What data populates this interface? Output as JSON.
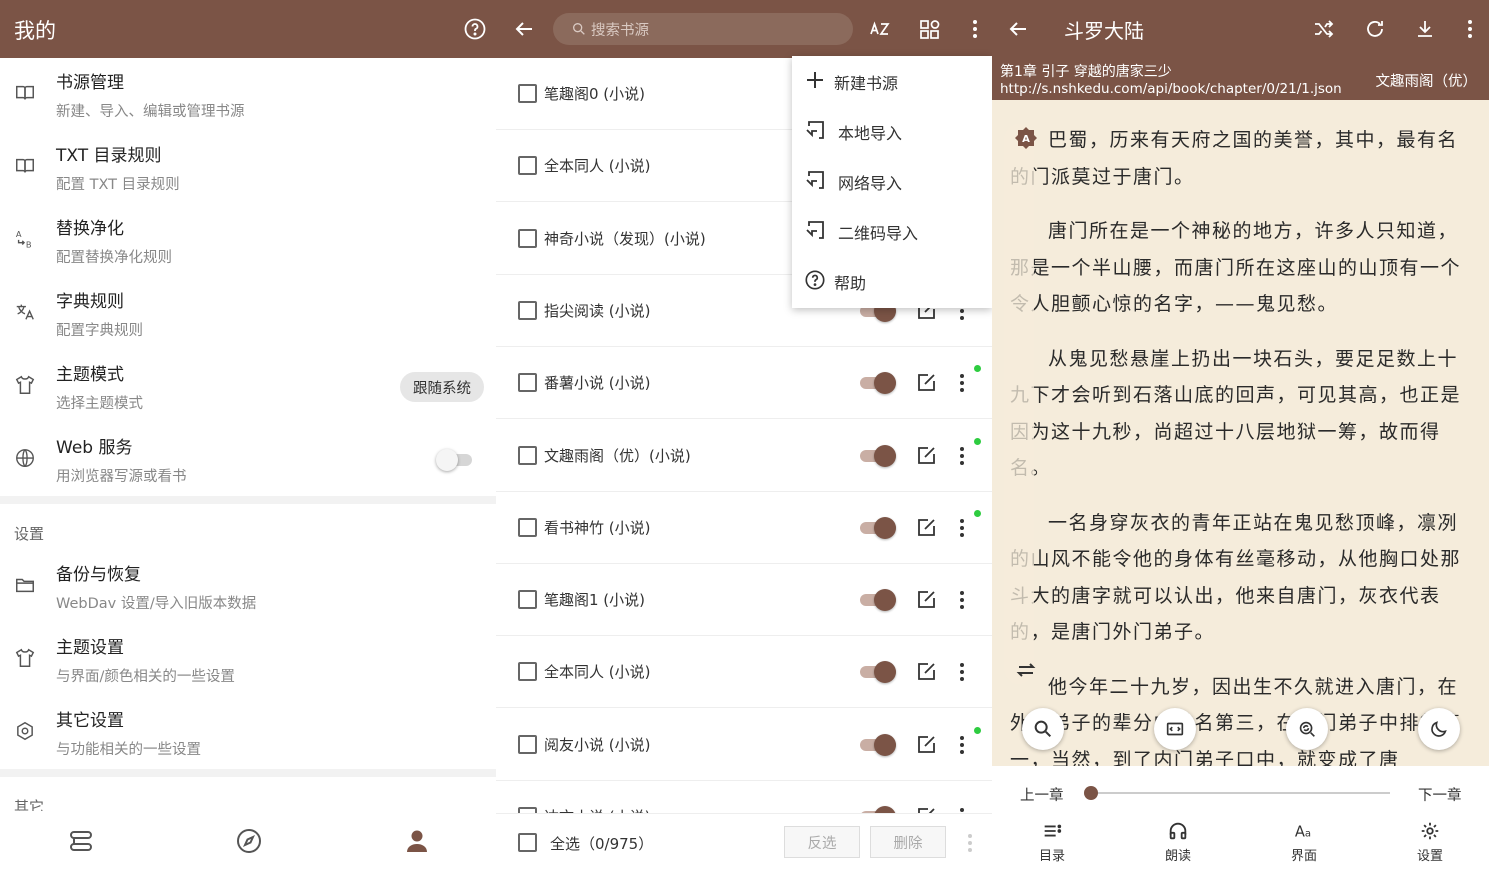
{
  "colors": {
    "primary": "#7b5446",
    "reader_bg": "#f5ecdb",
    "online_dot": "#2ecc40"
  },
  "panel1": {
    "title": "我的",
    "help_icon": "help-circle-icon",
    "items": [
      {
        "title": "书源管理",
        "subtitle": "新建、导入、编辑或管理书源",
        "icon": "book-icon"
      },
      {
        "title": "TXT 目录规则",
        "subtitle": "配置 TXT 目录规则",
        "icon": "book-icon"
      },
      {
        "title": "替换净化",
        "subtitle": "配置替换净化规则",
        "icon": "replace-icon"
      },
      {
        "title": "字典规则",
        "subtitle": "配置字典规则",
        "icon": "translate-icon"
      },
      {
        "title": "主题模式",
        "subtitle": "选择主题模式",
        "icon": "shirt-icon",
        "value": "跟随系统"
      },
      {
        "title": "Web 服务",
        "subtitle": "用浏览器写源或看书",
        "icon": "globe-icon"
      }
    ],
    "settings_section": "设置",
    "settings_items": [
      {
        "title": "备份与恢复",
        "subtitle": "WebDav 设置/导入旧版本数据",
        "icon": "folder-icon"
      },
      {
        "title": "主题设置",
        "subtitle": "与界面/颜色相关的一些设置",
        "icon": "shirt-icon"
      },
      {
        "title": "其它设置",
        "subtitle": "与功能相关的一些设置",
        "icon": "settings-icon"
      }
    ],
    "other_section": "其它",
    "nav": [
      "bookshelf-icon",
      "explore-icon",
      "profile-icon"
    ]
  },
  "panel2": {
    "search_placeholder": "搜索书源",
    "sources": [
      "笔趣阁0 (小说)",
      "全本同人 (小说)",
      "神奇小说（发现）(小说)",
      "指尖阅读 (小说)",
      "番薯小说 (小说)",
      "文趣雨阁（优）(小说)",
      "看书神竹 (小说)",
      "笔趣阁1 (小说)",
      "全本同人 (小说)",
      "阅友小说 (小说)",
      "达文小说 (小说)"
    ],
    "menu": [
      "新建书源",
      "本地导入",
      "网络导入",
      "二维码导入",
      "帮助"
    ],
    "select_all": "全选（0/975）",
    "invert": "反选",
    "delete": "删除"
  },
  "panel3": {
    "title": "斗罗大陆",
    "chapter": "第1章 引子 穿越的唐家三少",
    "url": "http://s.nshkedu.com/api/book/chapter/0/21/1.json",
    "source": "文趣雨阁（优）",
    "paragraphs": [
      "巴蜀，历来有天府之国的美誉，其中，最有名的门派莫过于唐门。",
      "唐门所在是一个神秘的地方，许多人只知道，那是一个半山腰，而唐门所在这座山的山顶有一个令人胆颤心惊的名字，——鬼见愁。",
      "从鬼见愁悬崖上扔出一块石头，要足足数上十九下才会听到石落山底的回声，可见其高，也正是因为这十九秒，尚超过十八层地狱一筹，故而得名。",
      "一名身穿灰衣的青年正站在鬼见愁顶峰，凛冽的山风不能令他的身体有丝毫移动，从他胸口处那斗大的唐字就可以认出，他来自唐门，灰衣代表的，是唐门外门弟子。",
      "他今年二十九岁，因出生不久就进入唐门，在外门弟子的辈分中排名第三，在外门弟子中排行第一，当然，到了内门弟子口中，就变成了唐"
    ],
    "prev_chapter": "上一章",
    "next_chapter": "下一章",
    "progress": 0.0,
    "bottom_tabs": [
      "目录",
      "朗读",
      "界面",
      "设置"
    ]
  }
}
